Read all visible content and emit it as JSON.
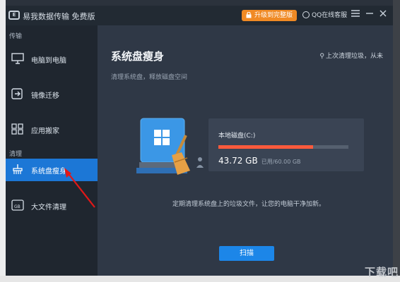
{
  "app": {
    "title": "易我数据传输 免费版",
    "upgrade_label": "升级到完整版",
    "support_label": "QQ在线客服"
  },
  "sidebar": {
    "section_transfer": "传输",
    "section_clean": "清理",
    "items": [
      {
        "label": "电脑到电脑",
        "icon": "monitor-icon"
      },
      {
        "label": "镜像迁移",
        "icon": "image-migrate-icon"
      },
      {
        "label": "应用搬家",
        "icon": "apps-grid-icon"
      },
      {
        "label": "系统盘瘦身",
        "icon": "broom-icon",
        "active": true
      },
      {
        "label": "大文件清理",
        "icon": "large-file-icon"
      }
    ]
  },
  "main": {
    "title": "系统盘瘦身",
    "subtitle": "清理系统盘，释放磁盘空间",
    "last_clean": "上次清理垃圾，从未",
    "drive": {
      "name": "本地磁盘(C:)",
      "used_value": "43.72 GB",
      "used_suffix": "已用/60.00 GB",
      "fill_fraction": 0.7287
    },
    "description": "定期清理系统盘上的垃圾文件，让您的电脑干净加新。",
    "scan_label": "扫描"
  },
  "watermark": "下载吧",
  "colors": {
    "accent": "#1c77d6",
    "upgrade": "#f08a24",
    "disk_bar": "#ff5a3c"
  }
}
